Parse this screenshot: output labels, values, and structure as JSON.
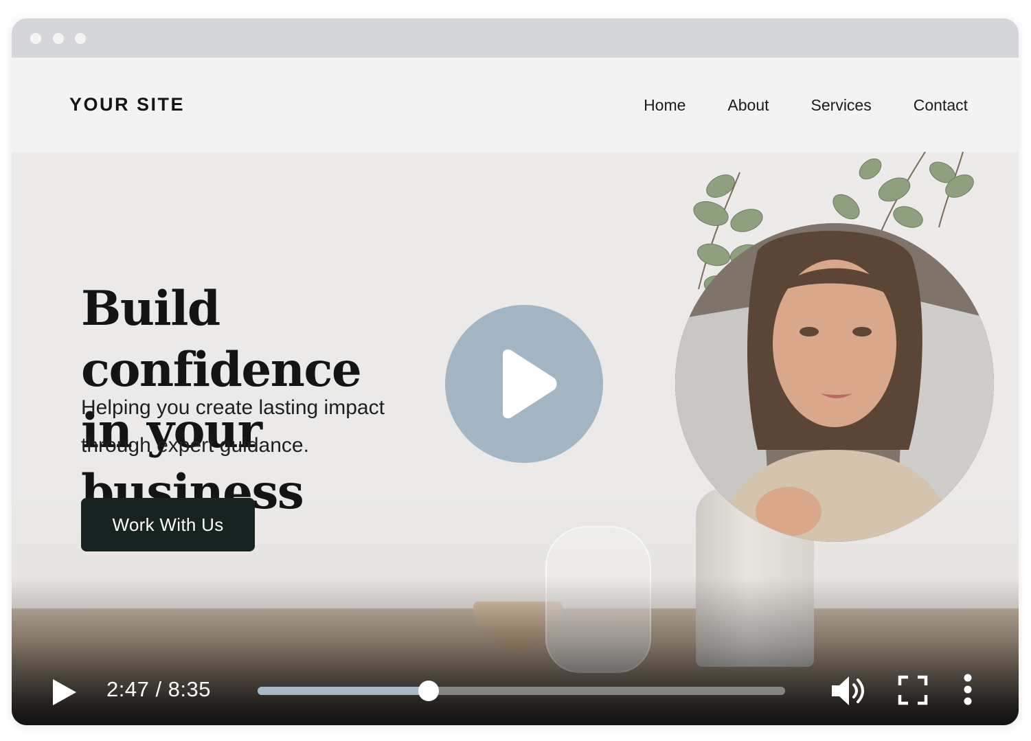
{
  "browser": {
    "window_dots": 3
  },
  "site": {
    "logo": "YOUR SITE",
    "nav": [
      {
        "label": "Home"
      },
      {
        "label": "About"
      },
      {
        "label": "Services"
      },
      {
        "label": "Contact"
      }
    ]
  },
  "hero": {
    "headline_line1": "Build confidence",
    "headline_line2": "in your business",
    "subtext_line1": "Helping you create lasting impact",
    "subtext_line2": "through expert guidance.",
    "cta_label": "Work With Us",
    "accent_color": "#a2b6c3",
    "cta_color": "#172320"
  },
  "video": {
    "time_display": "2:47 / 8:35",
    "progress_fraction": 0.324,
    "icons": [
      "play-icon",
      "volume-icon",
      "fullscreen-icon",
      "more-vertical-icon"
    ]
  }
}
